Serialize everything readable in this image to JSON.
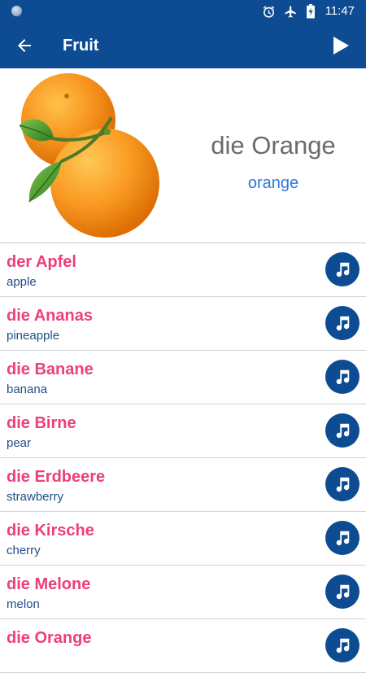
{
  "status_bar": {
    "time": "11:47",
    "icons": [
      "alarm-icon",
      "airplane-mode-icon",
      "battery-charging-icon"
    ]
  },
  "toolbar": {
    "title": "Fruit",
    "back_icon": "arrow-back-icon",
    "play_icon": "play-icon"
  },
  "hero": {
    "word": "die Orange",
    "translation": "orange",
    "image": "orange-fruit-image"
  },
  "words": [
    {
      "word": "der Apfel",
      "translation": "apple"
    },
    {
      "word": "die Ananas",
      "translation": "pineapple"
    },
    {
      "word": "die Banane",
      "translation": "banana"
    },
    {
      "word": "die Birne",
      "translation": "pear"
    },
    {
      "word": "die Erdbeere",
      "translation": "strawberry"
    },
    {
      "word": "die Kirsche",
      "translation": "cherry"
    },
    {
      "word": "die Melone",
      "translation": "melon"
    },
    {
      "word": "die Orange",
      "translation": ""
    }
  ],
  "colors": {
    "primary": "#0d4c93",
    "word_pink": "#ec407a",
    "translation_blue": "#1f4f86",
    "hero_translation": "#2b78d8",
    "hero_word": "#6b6b6b"
  }
}
